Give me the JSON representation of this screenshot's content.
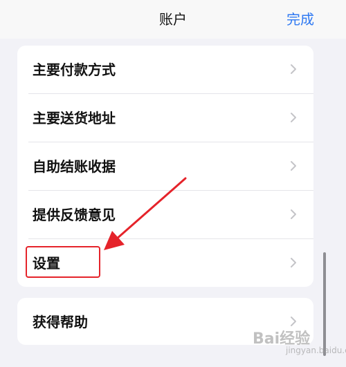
{
  "nav": {
    "title": "账户",
    "done_label": "完成"
  },
  "menu": {
    "items": [
      {
        "label": "主要付款方式"
      },
      {
        "label": "主要送货地址"
      },
      {
        "label": "自助结账收据"
      },
      {
        "label": "提供反馈意见"
      },
      {
        "label": "设置"
      }
    ]
  },
  "help": {
    "label": "获得帮助"
  },
  "annotation": {
    "color": "#e5232a"
  },
  "colors": {
    "accent": "#2f79f2",
    "background": "#f2f2f7",
    "card": "#ffffff"
  },
  "watermark": {
    "text": "Bai经验",
    "subtext": "jingyan.baidu.com"
  }
}
